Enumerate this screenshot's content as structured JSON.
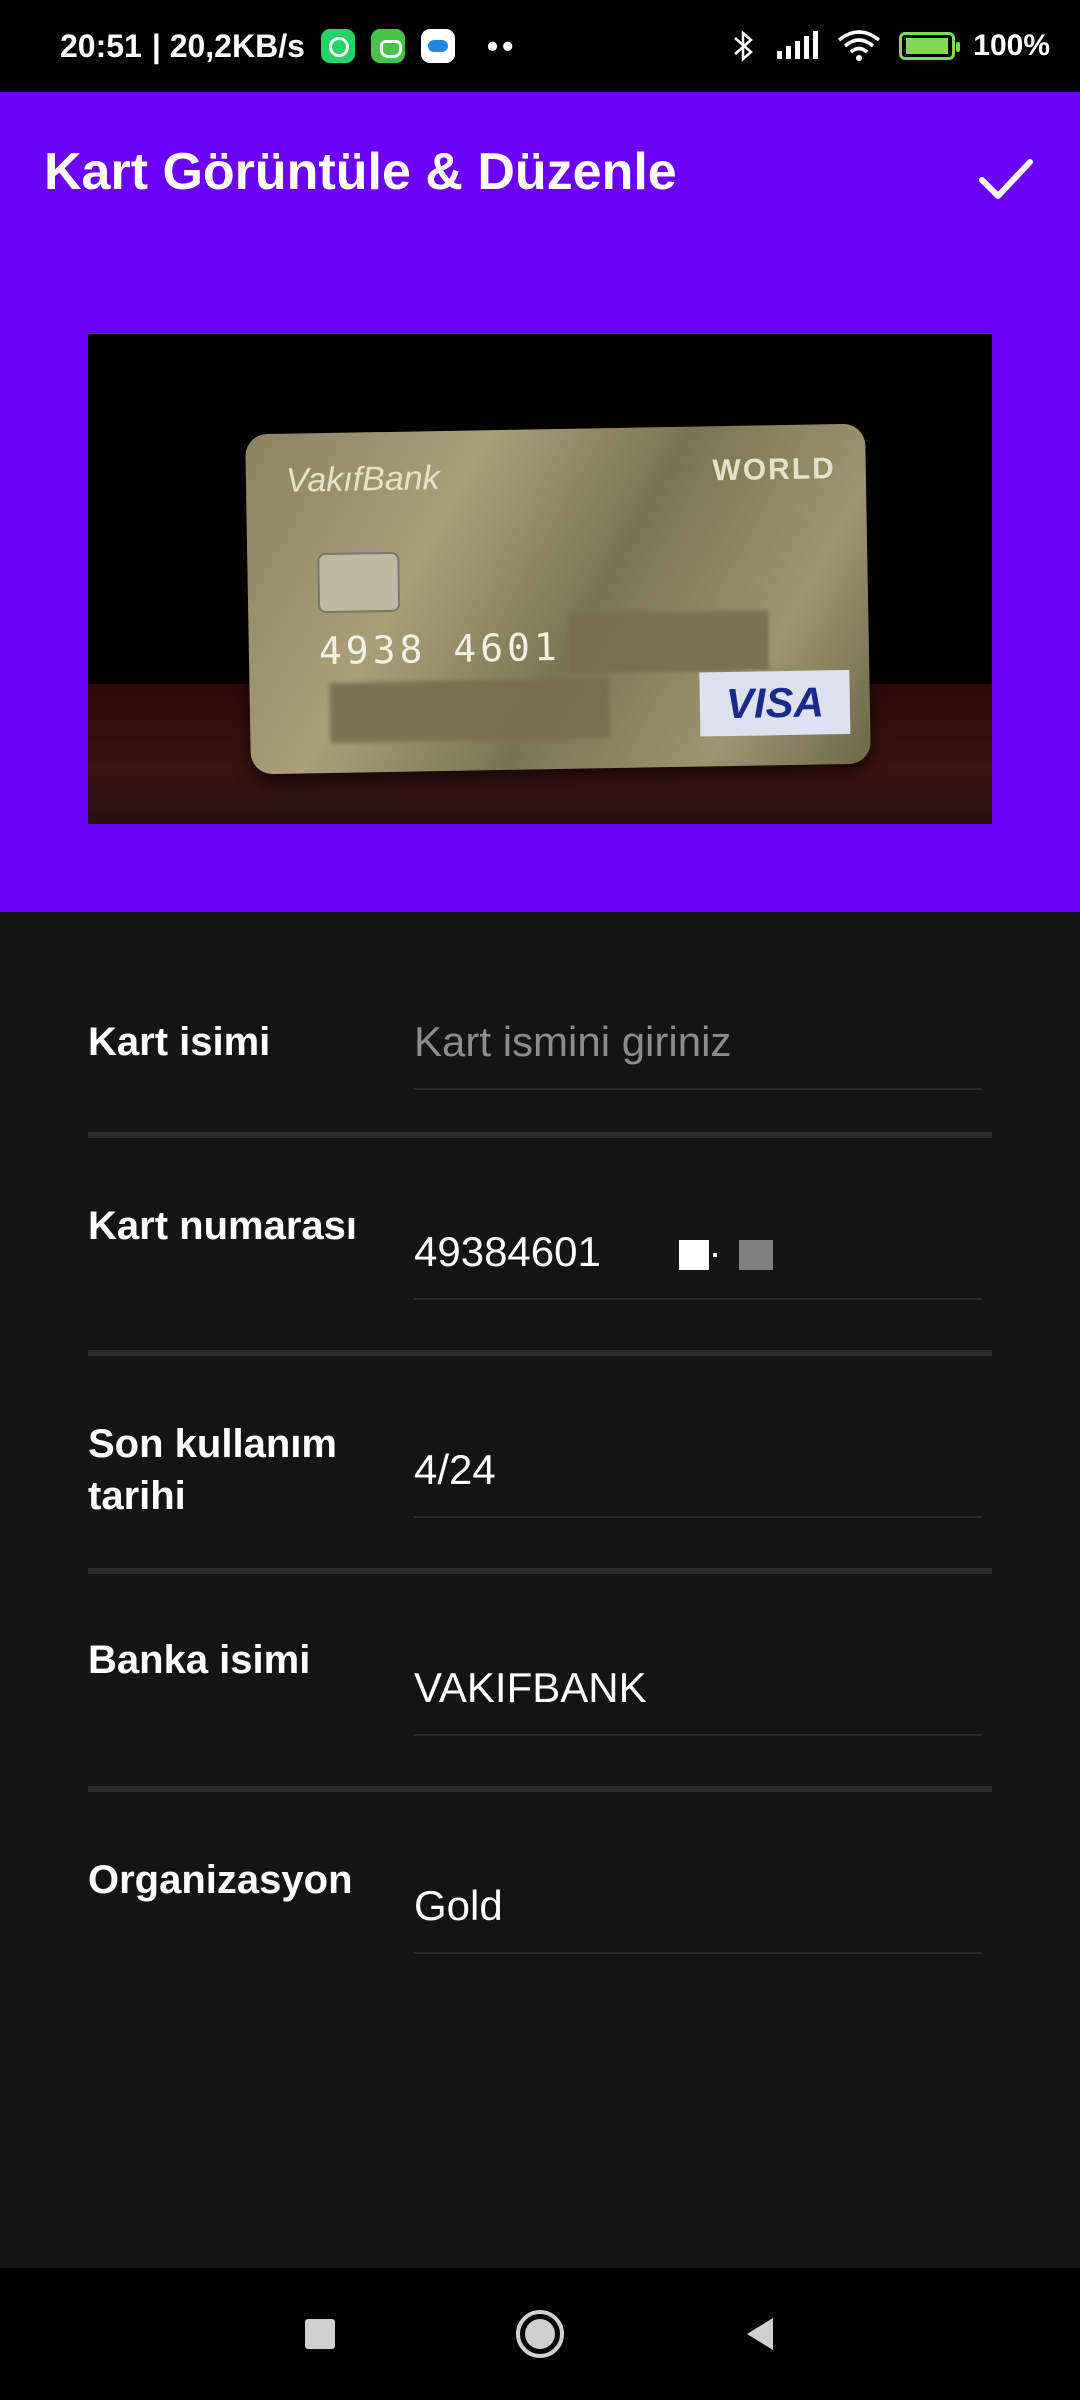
{
  "status_bar": {
    "time": "20:51",
    "network_speed": "| 20,2KB/s",
    "dots": "••",
    "battery": "100%",
    "icons": [
      "whatsapp-icon",
      "cat-app-icon",
      "cloud-icon",
      "bluetooth-icon",
      "signal-icon",
      "wifi-icon",
      "battery-icon"
    ]
  },
  "header": {
    "title": "Kart Görüntüle & Düzenle",
    "confirm_icon": "check-icon",
    "background_color": "#6a00f4"
  },
  "card_image": {
    "bank_text": "VakıfBank",
    "tier_text": "WORLD",
    "number_text": "4938 4601",
    "network_text": "VISA"
  },
  "form": {
    "card_name": {
      "label": "Kart isimi",
      "value": "",
      "placeholder": "Kart ismini giriniz"
    },
    "card_number": {
      "label": "Kart numarası",
      "value": "49384601"
    },
    "expiry": {
      "label": "Son kullanım tarihi",
      "value": "4/24"
    },
    "bank_name": {
      "label": "Banka isimi",
      "value": "VAKIFBANK"
    },
    "organization": {
      "label": "Organizasyon",
      "value": "Gold"
    }
  },
  "nav_bar": {
    "icons": [
      "square-icon",
      "circle-icon",
      "back-triangle-icon"
    ]
  }
}
